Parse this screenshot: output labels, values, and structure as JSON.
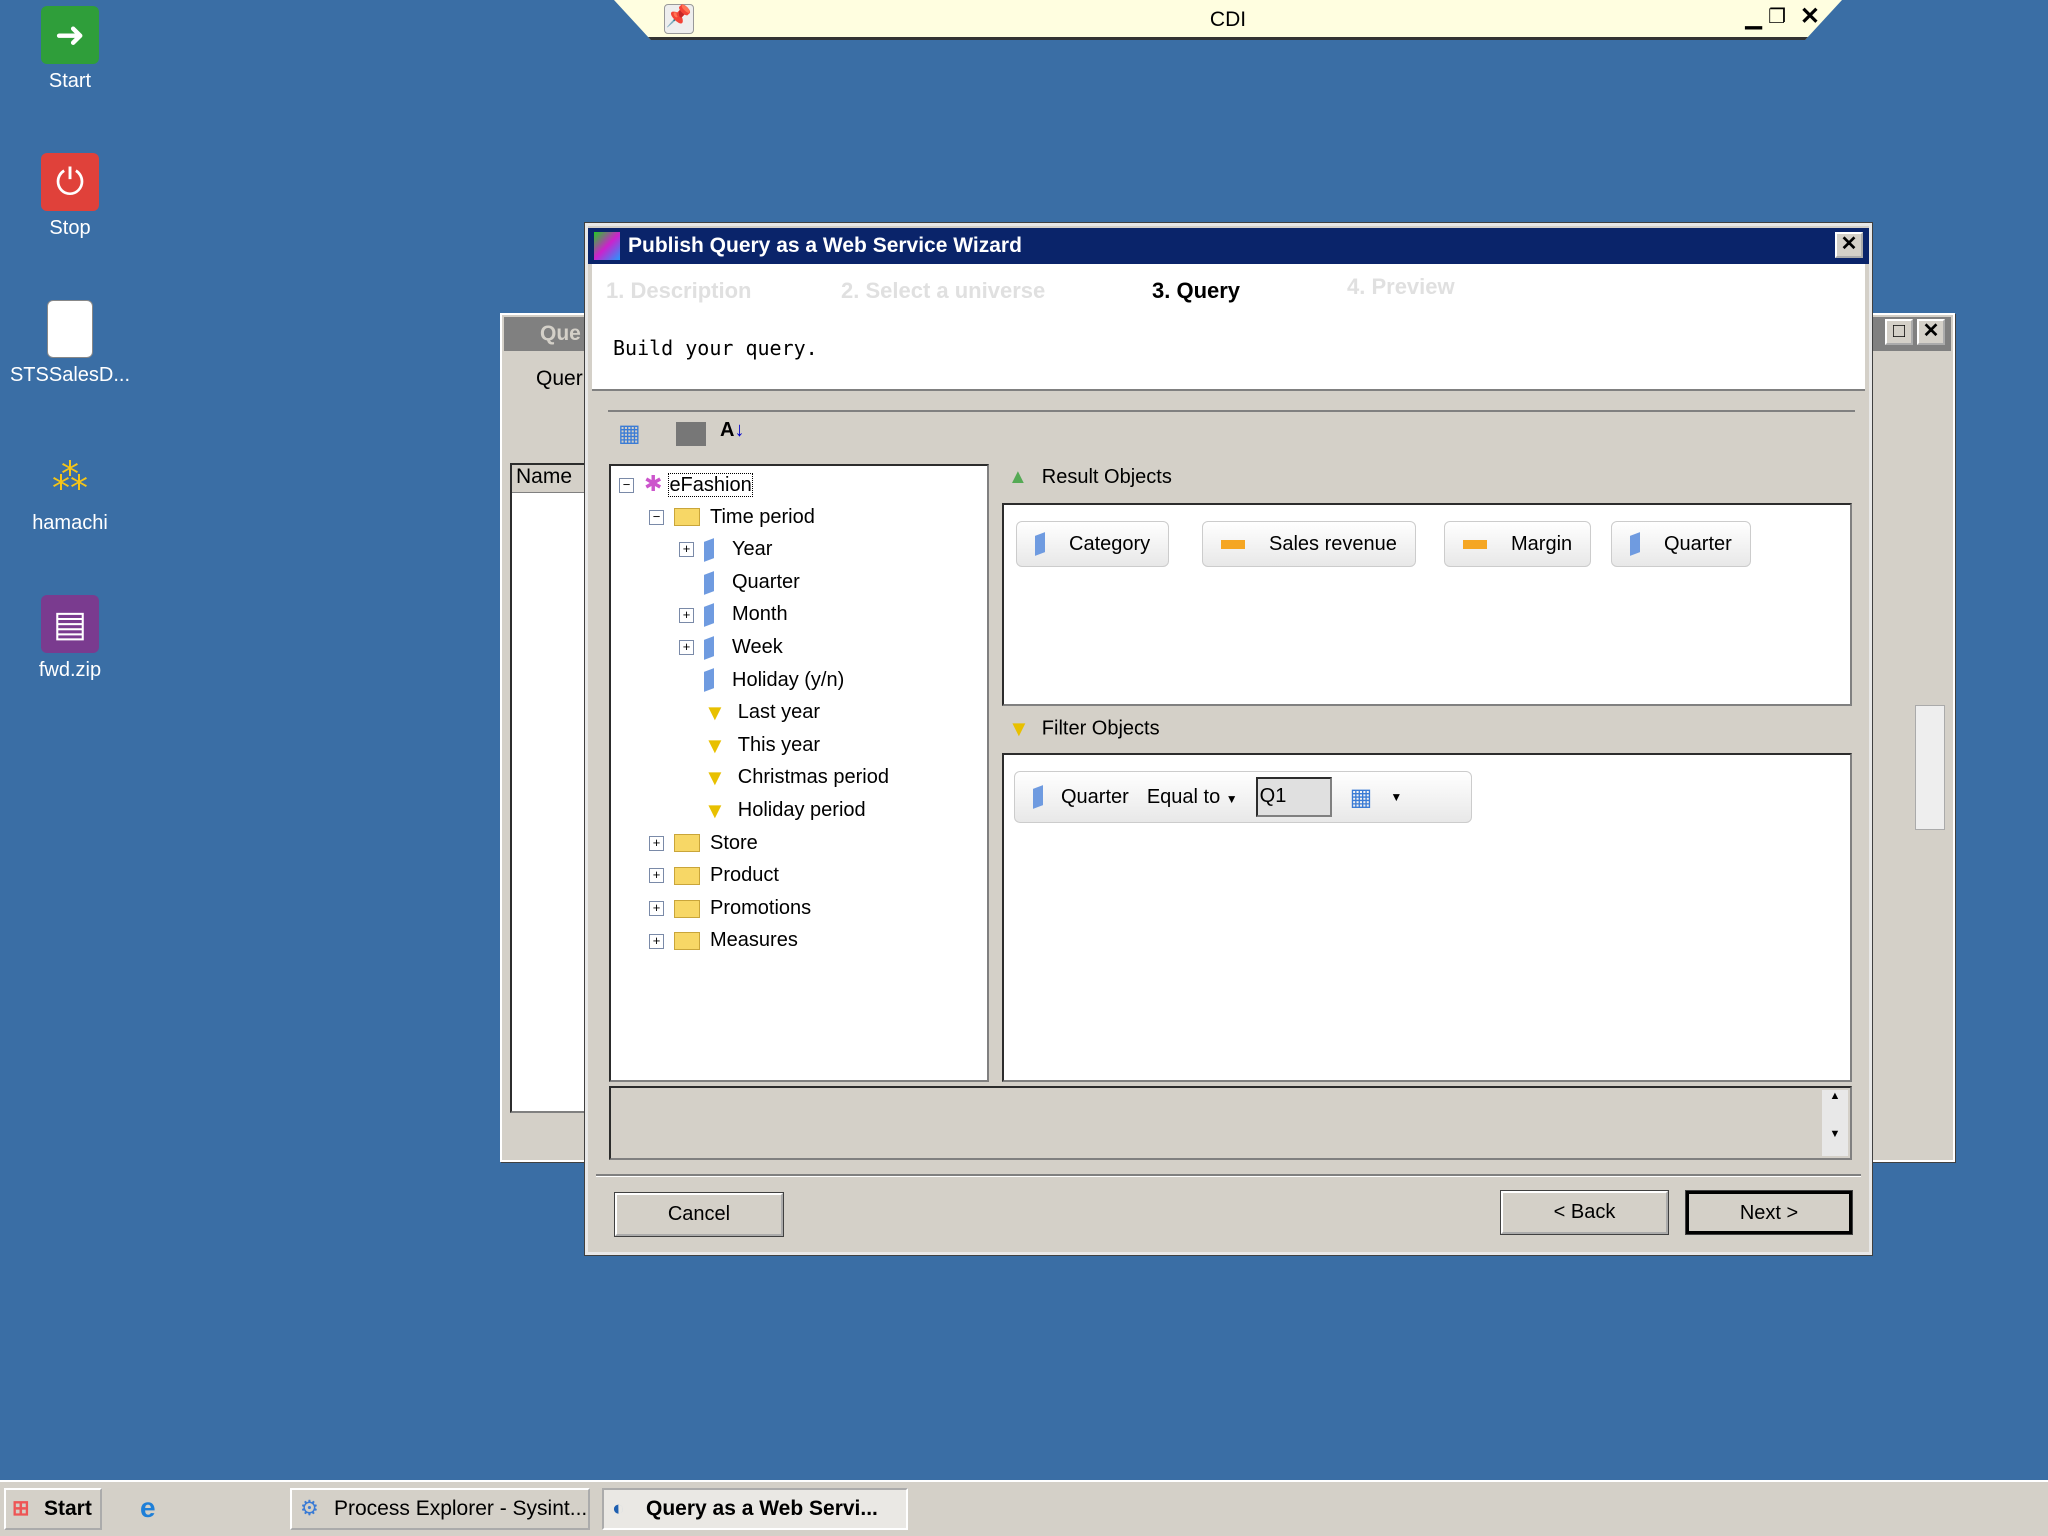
{
  "desktop": {
    "icons": [
      {
        "label": "Start"
      },
      {
        "label": "Stop"
      },
      {
        "label": "STSSalesD..."
      },
      {
        "label": "hamachi"
      },
      {
        "label": "fwd.zip"
      }
    ]
  },
  "remote_bar": {
    "title": "CDI"
  },
  "background_window": {
    "title": "Que",
    "menu": "Quer",
    "column": "Name"
  },
  "wizard": {
    "title": "Publish Query as a Web Service Wizard",
    "steps": [
      "1. Description",
      "2. Select a universe",
      "3. Query",
      "4. Preview"
    ],
    "instruction": "Build your query.",
    "tree": {
      "root": "eFashion",
      "items": [
        {
          "label": "Time period",
          "type": "folder",
          "toggle": "−"
        },
        {
          "label": "Year",
          "type": "dim",
          "toggle": "+"
        },
        {
          "label": "Quarter",
          "type": "dim",
          "toggle": ""
        },
        {
          "label": "Month",
          "type": "dim",
          "toggle": "+"
        },
        {
          "label": "Week",
          "type": "dim",
          "toggle": "+"
        },
        {
          "label": "Holiday (y/n)",
          "type": "dim",
          "toggle": ""
        },
        {
          "label": "Last year",
          "type": "filter",
          "toggle": ""
        },
        {
          "label": "This year",
          "type": "filter",
          "toggle": ""
        },
        {
          "label": "Christmas period",
          "type": "filter",
          "toggle": ""
        },
        {
          "label": "Holiday period",
          "type": "filter",
          "toggle": ""
        },
        {
          "label": "Store",
          "type": "folder",
          "toggle": "+"
        },
        {
          "label": "Product",
          "type": "folder",
          "toggle": "+"
        },
        {
          "label": "Promotions",
          "type": "folder",
          "toggle": "+"
        },
        {
          "label": "Measures",
          "type": "folder",
          "toggle": "+"
        }
      ]
    },
    "result_header": "Result Objects",
    "result_objects": [
      {
        "label": "Category",
        "type": "dim"
      },
      {
        "label": "Sales revenue",
        "type": "measure"
      },
      {
        "label": "Margin",
        "type": "measure"
      },
      {
        "label": "Quarter",
        "type": "dim"
      }
    ],
    "filter_header": "Filter Objects",
    "filter": {
      "object": "Quarter",
      "operator": "Equal to",
      "value": "Q1"
    },
    "buttons": {
      "cancel": "Cancel",
      "back": "< Back",
      "next": "Next >"
    }
  },
  "taskbar": {
    "start": "Start",
    "tasks": [
      "Process Explorer - Sysint...",
      "Query as a Web Servi..."
    ]
  }
}
